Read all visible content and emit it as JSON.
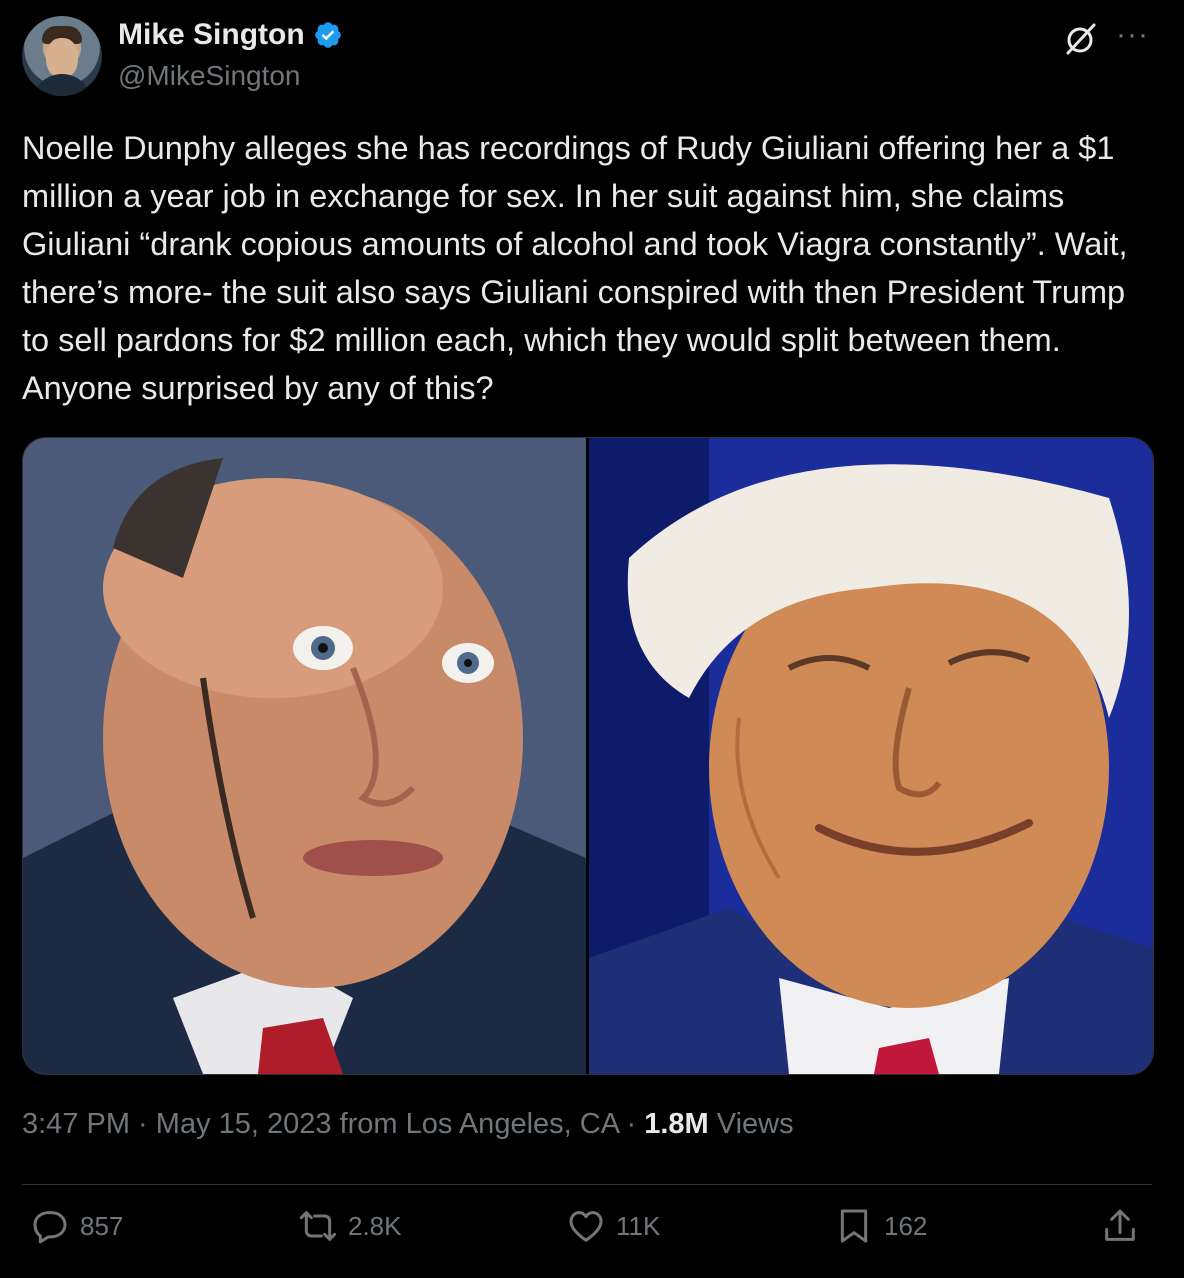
{
  "author": {
    "display_name": "Mike Sington",
    "handle": "@MikeSington",
    "verified": true
  },
  "tweet": {
    "text": "Noelle Dunphy alleges she has recordings of Rudy Giuliani offering her a $1 million a year job in exchange for sex. In her suit against him, she claims Giuliani “drank copious amounts of alcohol and took Viagra constantly”. Wait, there’s more- the suit also says Giuliani conspired with then President Trump to sell pardons for $2 million each, which they would split between them. Anyone surprised by any of this?"
  },
  "media": {
    "photos": [
      {
        "icon": "photo-of-man-surprised-expression"
      },
      {
        "icon": "photo-of-man-smiling"
      }
    ]
  },
  "meta": {
    "time": "3:47 PM",
    "separator": " · ",
    "date": "May 15, 2023",
    "location": " from Los Angeles, CA",
    "separator2": " · ",
    "views_count": "1.8M",
    "views_label": " Views"
  },
  "actions": {
    "replies": "857",
    "reposts": "2.8K",
    "likes": "11K",
    "bookmarks": "162"
  },
  "colors": {
    "background": "#000000",
    "text": "#e7e9ea",
    "muted": "#71767b",
    "verified": "#1d9bf0",
    "border": "#2f3336"
  }
}
